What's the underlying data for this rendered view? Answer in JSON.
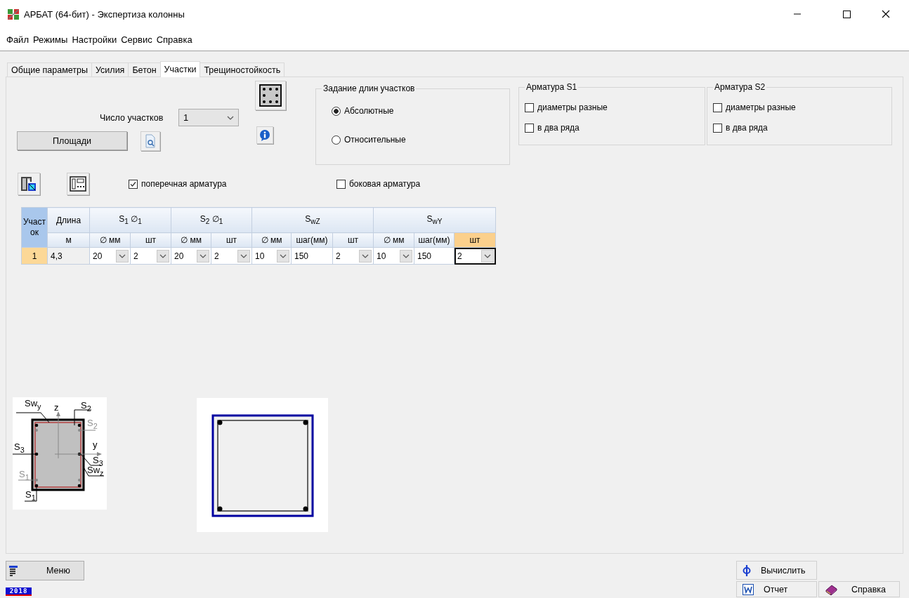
{
  "window": {
    "title": "АРБАТ (64-бит) - Экспертиза колонны"
  },
  "menu": [
    "Файл",
    "Режимы",
    "Настройки",
    "Сервис",
    "Справка"
  ],
  "tabs": [
    {
      "label": "Общие параметры",
      "selected": false
    },
    {
      "label": "Усилия",
      "selected": false
    },
    {
      "label": "Бетон",
      "selected": false
    },
    {
      "label": "Участки",
      "selected": true
    },
    {
      "label": "Трещиностойкость",
      "selected": false
    }
  ],
  "sections_count": {
    "label": "Число участков",
    "value": "1"
  },
  "areas_button": "Площади",
  "length_mode": {
    "title": "Задание длин участков",
    "options": [
      {
        "label": "Абсолютные",
        "selected": true
      },
      {
        "label": "Относительные",
        "selected": false
      }
    ]
  },
  "rebar_groups": [
    {
      "title": "Арматура S1",
      "options": [
        {
          "label": "диаметры разные",
          "checked": false
        },
        {
          "label": "в два ряда",
          "checked": false
        }
      ]
    },
    {
      "title": "Арматура S2",
      "options": [
        {
          "label": "диаметры разные",
          "checked": false
        },
        {
          "label": "в два ряда",
          "checked": false
        }
      ]
    }
  ],
  "options": [
    {
      "label": "поперечная арматура",
      "checked": true
    },
    {
      "label": "боковая арматура",
      "checked": false
    }
  ],
  "table": {
    "corner": "Участок",
    "groups": [
      {
        "label": "Длина",
        "columns": [
          {
            "label": "м",
            "selected": false
          }
        ]
      },
      {
        "label": "S$_{1}$ ∅$_{1}$",
        "columns": [
          {
            "label": "∅ мм",
            "selected": false
          },
          {
            "label": "шт",
            "selected": false
          }
        ]
      },
      {
        "label": "S$_{2}$ ∅$_{1}$",
        "columns": [
          {
            "label": "∅ мм",
            "selected": false
          },
          {
            "label": "шт",
            "selected": false
          }
        ]
      },
      {
        "label": "S$_{wZ}$",
        "columns": [
          {
            "label": "∅ мм",
            "selected": false
          },
          {
            "label": "шаг(мм)",
            "selected": false
          },
          {
            "label": "шт",
            "selected": false
          }
        ]
      },
      {
        "label": "S$_{wY}$",
        "columns": [
          {
            "label": "∅ мм",
            "selected": false
          },
          {
            "label": "шаг(мм)",
            "selected": false
          },
          {
            "label": "шт",
            "selected": true
          }
        ]
      }
    ],
    "rows": [
      {
        "number": "1",
        "selected": true,
        "cells": [
          {
            "kind": "readonly",
            "value": "4,3",
            "focused": false
          },
          {
            "kind": "combo",
            "value": "20",
            "focused": false
          },
          {
            "kind": "combo",
            "value": "2",
            "focused": false
          },
          {
            "kind": "combo",
            "value": "20",
            "focused": false
          },
          {
            "kind": "combo",
            "value": "2",
            "focused": false
          },
          {
            "kind": "combo",
            "value": "10",
            "focused": false
          },
          {
            "kind": "text",
            "value": "150",
            "focused": false
          },
          {
            "kind": "combo",
            "value": "2",
            "focused": false
          },
          {
            "kind": "combo",
            "value": "10",
            "focused": false
          },
          {
            "kind": "text",
            "value": "150",
            "focused": false
          },
          {
            "kind": "combo",
            "value": "2",
            "focused": true
          }
        ]
      }
    ]
  },
  "diagram_labels": [
    {
      "text": "Sw$_{y}$",
      "muted": false
    },
    {
      "text": "z",
      "muted": false
    },
    {
      "text": "S$_{2}$",
      "muted": false
    },
    {
      "text": "S$_{2}$",
      "muted": true
    },
    {
      "text": "S$_{3}$",
      "muted": false
    },
    {
      "text": "y",
      "muted": false
    },
    {
      "text": "S$_{3}$",
      "muted": false
    },
    {
      "text": "Sw$_{z}$",
      "muted": false
    },
    {
      "text": "S$_{1}$",
      "muted": true
    },
    {
      "text": "S$_{1}$",
      "muted": false
    }
  ],
  "bottom": {
    "menu_button": "Меню",
    "version": "2018",
    "buttons": [
      {
        "kind": "calculate",
        "label": "Вычислить"
      },
      {
        "kind": "report",
        "label": "Отчет"
      },
      {
        "kind": "help",
        "label": "Справка"
      }
    ]
  }
}
